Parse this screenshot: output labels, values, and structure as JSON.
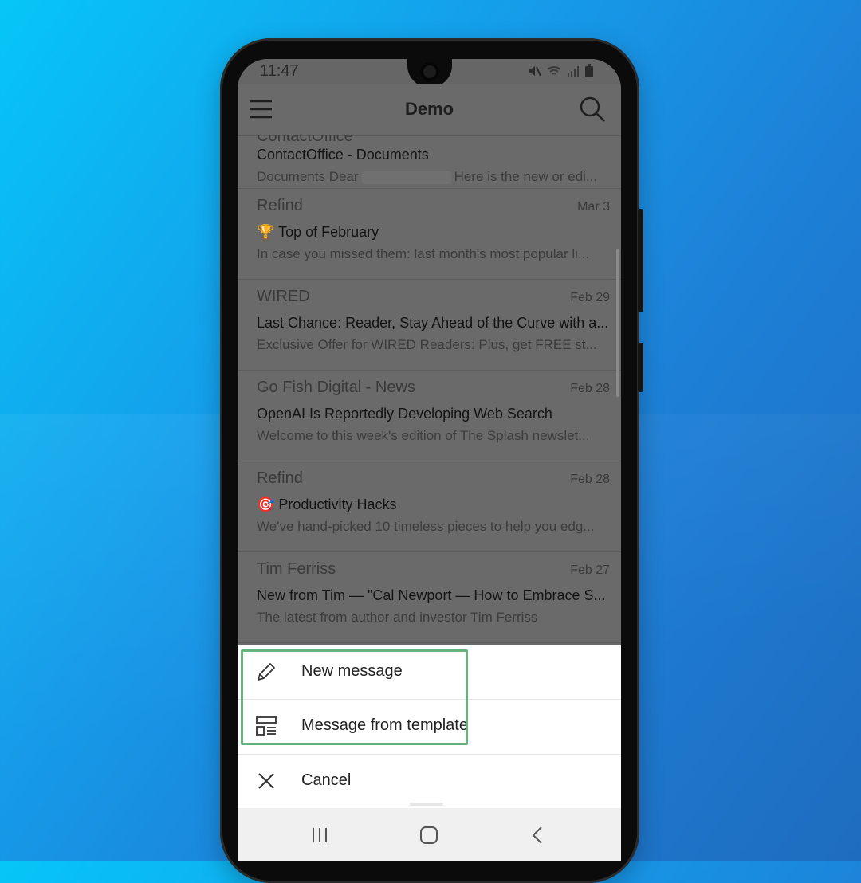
{
  "status_bar": {
    "time": "11:47"
  },
  "app_bar": {
    "title": "Demo"
  },
  "mail_list": {
    "cut_off_sender": "ContactOffice",
    "items": [
      {
        "sender": "",
        "date": "",
        "subject": "ContactOffice - Documents",
        "preview_before": "Documents Dear",
        "preview_after": "Here is the new or edi..."
      },
      {
        "sender": "Refind",
        "date": "Mar 3",
        "subject": "🏆 Top of February",
        "preview": "In case you missed them: last month's most popular li..."
      },
      {
        "sender": "WIRED",
        "date": "Feb 29",
        "subject": "Last Chance: Reader, Stay Ahead of the Curve with a...",
        "preview": "Exclusive Offer for WIRED Readers: Plus, get FREE st..."
      },
      {
        "sender": "Go Fish Digital - News",
        "date": "Feb 28",
        "subject": "OpenAI Is Reportedly Developing Web Search",
        "preview": "Welcome to this week's edition of The Splash newslet..."
      },
      {
        "sender": "Refind",
        "date": "Feb 28",
        "subject": "🎯 Productivity Hacks",
        "preview": "We've hand-picked 10 timeless pieces to help you edg..."
      },
      {
        "sender": "Tim Ferriss",
        "date": "Feb 27",
        "subject": "New from Tim — \"Cal Newport — How to Embrace S...",
        "preview": "The latest from author and investor Tim Ferriss"
      }
    ]
  },
  "sheet": {
    "new_message": "New message",
    "message_from_template": "Message from template",
    "cancel": "Cancel",
    "highlight_color": "#69b27c"
  },
  "icons": {
    "menu": "hamburger-menu-icon",
    "search": "search-icon",
    "new_message": "pencil-icon",
    "template": "template-icon",
    "cancel": "close-icon"
  }
}
